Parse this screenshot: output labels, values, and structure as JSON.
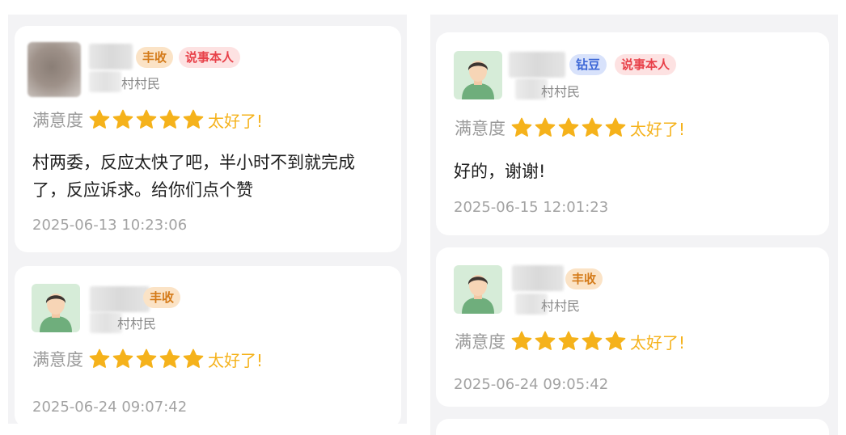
{
  "reviews": [
    {
      "tags": [
        "丰收",
        "说事本人"
      ],
      "village": "村村民",
      "rating_label": "满意度",
      "stars": 5,
      "rating_text": "太好了!",
      "comment": "村两委，反应太快了吧，半小时不到就完成了，反应诉求。给你们点个赞",
      "timestamp": "2025-06-13 10:23:06"
    },
    {
      "tags": [
        "丰收"
      ],
      "village": "村村民",
      "rating_label": "满意度",
      "stars": 5,
      "rating_text": "太好了!",
      "comment": "",
      "timestamp": "2025-06-24 09:07:42"
    },
    {
      "tags": [
        "钻豆",
        "说事本人"
      ],
      "village": "村村民",
      "rating_label": "满意度",
      "stars": 5,
      "rating_text": "太好了!",
      "comment": "好的，谢谢!",
      "timestamp": "2025-06-15 12:01:23"
    },
    {
      "tags": [
        "丰收"
      ],
      "village": "村村民",
      "rating_label": "满意度",
      "stars": 5,
      "rating_text": "太好了!",
      "comment": "",
      "timestamp": "2025-06-24 09:05:42"
    }
  ],
  "colors": {
    "star": "#f5b21b",
    "tag_fengshou_bg": "#fbe3c6",
    "tag_fengshou_text": "#d47a18",
    "tag_zuandou_bg": "#d8e2fb",
    "tag_zuandou_text": "#3b66d6",
    "tag_speaker_bg": "#fde2e2",
    "tag_speaker_text": "#e8414a"
  }
}
